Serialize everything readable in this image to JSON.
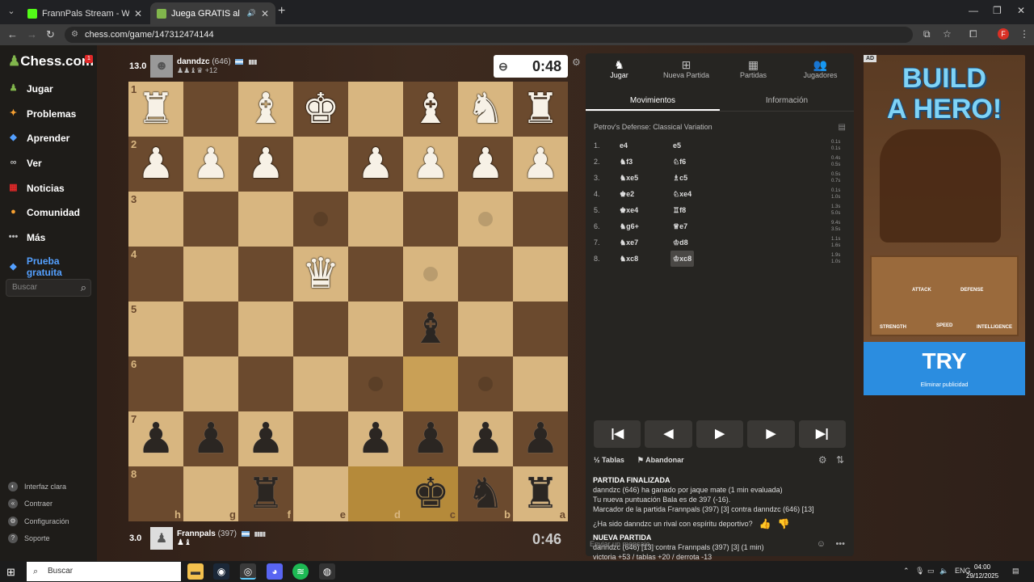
{
  "browser": {
    "tabs": [
      {
        "title": "FrannPals Stream - Watch Live o",
        "active": false,
        "favicon_color": "#53fc18"
      },
      {
        "title": "Juega GRATIS al ajedrez onl",
        "active": true,
        "favicon_color": "#81b64c"
      }
    ],
    "url": "chess.com/game/147312474144",
    "profile_initial": "F"
  },
  "sidebar": {
    "logo": "Chess.com",
    "logo_badge": "1",
    "items": [
      {
        "label": "Jugar",
        "icon": "play-icon",
        "color": "#81b64c"
      },
      {
        "label": "Problemas",
        "icon": "puzzle-icon",
        "color": "#f7a031"
      },
      {
        "label": "Aprender",
        "icon": "learn-icon",
        "color": "#54a0ff"
      },
      {
        "label": "Ver",
        "icon": "binoculars-icon",
        "color": "#bbbbbb"
      },
      {
        "label": "Noticias",
        "icon": "news-icon",
        "color": "#e02828"
      },
      {
        "label": "Comunidad",
        "icon": "community-icon",
        "color": "#f7a031"
      },
      {
        "label": "Más",
        "icon": "more-icon",
        "color": "#bbbbbb"
      }
    ],
    "trial_label": "Prueba gratuita",
    "search_placeholder": "Buscar",
    "bottom": [
      {
        "label": "Interfaz clara",
        "icon": "theme-icon"
      },
      {
        "label": "Contraer",
        "icon": "collapse-icon"
      },
      {
        "label": "Configuración",
        "icon": "gear-icon"
      },
      {
        "label": "Soporte",
        "icon": "help-icon"
      }
    ]
  },
  "top_player": {
    "score": "13.0",
    "name": "danndzc",
    "rating": "(646)",
    "captured": "♟♟♝♛ +12",
    "clock": "0:48"
  },
  "bottom_player": {
    "score": "3.0",
    "name": "Frannpals",
    "rating": "(397)",
    "captured": "♟♝",
    "clock": "0:46"
  },
  "board": {
    "ranks": [
      "1",
      "2",
      "3",
      "4",
      "5",
      "6",
      "7",
      "8"
    ],
    "files": [
      "h",
      "g",
      "f",
      "e",
      "d",
      "c",
      "b",
      "a"
    ],
    "rows": [
      [
        "wR",
        "",
        "wB",
        "wK",
        "",
        "wB",
        "wN",
        "wR"
      ],
      [
        "wP",
        "wP",
        "wP",
        "",
        "wP",
        "wP",
        "wP",
        "wP"
      ],
      [
        "",
        "",
        "",
        "",
        "",
        "",
        "",
        ""
      ],
      [
        "",
        "",
        "",
        "wQ",
        "",
        "",
        "",
        ""
      ],
      [
        "",
        "",
        "",
        "",
        "",
        "bB",
        "",
        ""
      ],
      [
        "",
        "",
        "",
        "",
        "",
        "",
        "",
        ""
      ],
      [
        "bP",
        "bP",
        "bP",
        "",
        "bP",
        "bP",
        "bP",
        "bP"
      ],
      [
        "",
        "",
        "bR",
        "",
        "",
        "bK",
        "bN",
        "bR"
      ]
    ],
    "highlights": [
      "5-5",
      "7-4",
      "7-5"
    ]
  },
  "panel": {
    "tabs": [
      {
        "label": "Jugar",
        "icon": "play-icon"
      },
      {
        "label": "Nueva Partida",
        "icon": "plus-icon"
      },
      {
        "label": "Partidas",
        "icon": "board-icon"
      },
      {
        "label": "Jugadores",
        "icon": "players-icon"
      }
    ],
    "subtabs": [
      "Movimientos",
      "Información"
    ],
    "opening": "Petrov's Defense: Classical Variation",
    "moves": [
      {
        "num": "1.",
        "white": "e4",
        "black": "e5",
        "wt": "0.1s",
        "bt": "0.1s"
      },
      {
        "num": "2.",
        "white": "♞f3",
        "black": "♘f6",
        "wt": "0.4s",
        "bt": "0.5s"
      },
      {
        "num": "3.",
        "white": "♞xe5",
        "black": "♗c5",
        "wt": "0.5s",
        "bt": "0.7s"
      },
      {
        "num": "4.",
        "white": "♚e2",
        "black": "♘xe4",
        "wt": "0.1s",
        "bt": "1.0s"
      },
      {
        "num": "5.",
        "white": "♚xe4",
        "black": "♖f8",
        "wt": "1.3s",
        "bt": "5.0s"
      },
      {
        "num": "6.",
        "white": "♞g6+",
        "black": "♕e7",
        "wt": "9.4s",
        "bt": "3.5s"
      },
      {
        "num": "7.",
        "white": "♞xe7",
        "black": "♔d8",
        "wt": "1.1s",
        "bt": "1.6s"
      },
      {
        "num": "8.",
        "white": "♞xc8",
        "black": "♔xc8",
        "wt": "1.9s",
        "bt": "1.0s"
      }
    ],
    "controls": [
      "|◀",
      "◀",
      "▶",
      "▶",
      "▶|"
    ],
    "draw_label": "Tablas",
    "resign_label": "Abandonar",
    "chat": {
      "h1": "PARTIDA FINALIZADA",
      "l1": "danndzc (646) ha ganado por jaque mate (1 min evaluada)",
      "l2": "Tu nueva puntuación Bala es de 397 (-16).",
      "l3": "Marcador de la partida Frannpals (397) [3] contra danndzc (646) [13]",
      "l4": "¿Ha sido danndzc un rival con espíritu deportivo?",
      "h2": "NUEVA PARTIDA",
      "l5": "danndzc (646) [13] contra Frannpals (397) [3] (1 min)",
      "l6": "victoria +53 / tablas +20 / derrota -13"
    },
    "chat_placeholder": "Enviar un mensaje..."
  },
  "ad": {
    "tag": "AD",
    "title1": "BUILD",
    "title2": "A HERO!",
    "skills": [
      "ATTACK",
      "DEFENSE",
      "STRENGTH",
      "SPEED",
      "INTELLIGENCE"
    ],
    "cta": "TRY",
    "remove": "Eliminar publicidad"
  },
  "taskbar": {
    "search": "Buscar",
    "lang": "ENG",
    "time": "04:00",
    "date": "29/12/2025"
  }
}
